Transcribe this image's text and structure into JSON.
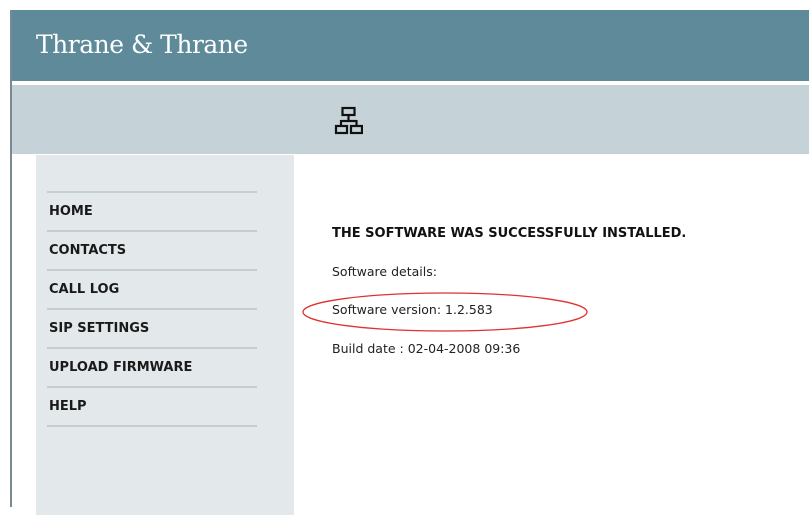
{
  "header": {
    "brand": "Thrane & Thrane",
    "background_color": "#5e8a99",
    "icon": "network-icon"
  },
  "iconbar": {
    "background_color": "#c5d2d7"
  },
  "sidebar": {
    "background_color": "#e3e9eb",
    "items": [
      {
        "label": "HOME"
      },
      {
        "label": "CONTACTS"
      },
      {
        "label": "CALL LOG"
      },
      {
        "label": "SIP SETTINGS"
      },
      {
        "label": "UPLOAD FIRMWARE"
      },
      {
        "label": "HELP"
      }
    ]
  },
  "content": {
    "success_message": "THE SOFTWARE WAS SUCCESSFULLY INSTALLED.",
    "details_label": "Software details:",
    "software_version": "Software version: 1.2.583",
    "build_date": "Build date : 02-04-2008 09:36",
    "highlight_color": "#e03030"
  }
}
